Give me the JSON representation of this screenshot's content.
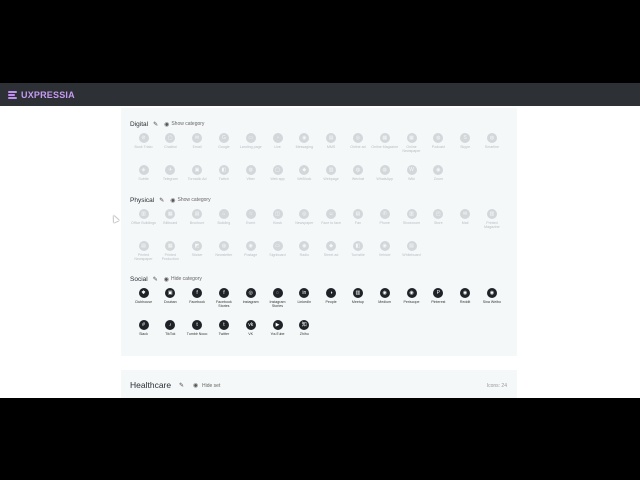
{
  "app": {
    "logo_text": "UXPRESSIA",
    "accent": "#c79bf2",
    "topbar_color": "#2d3136"
  },
  "categories": [
    {
      "title": "Digital",
      "action": "Show category",
      "state": "faded",
      "items": [
        "Book Trialo",
        "Chatbot",
        "Email",
        "Google",
        "Landing page",
        "Live",
        "Messaging",
        "MMS",
        "Online ad",
        "Online Magazine",
        "Online Newspaper",
        "Podcast",
        "Skype",
        "Smarline",
        "Subtle",
        "Telegram",
        "Tornadic Ad",
        "Twitch",
        "Viber",
        "Web app",
        "WeBlock",
        "Webpage",
        "Wechat",
        "WhatsApp",
        "Wiki",
        "Zoom"
      ]
    },
    {
      "title": "Physical",
      "action": "Show category",
      "state": "faded",
      "items": [
        "Office Buildings",
        "Billboard",
        "Brochure",
        "Building",
        "Event",
        "Kiosk",
        "Newspaper",
        "Face to face",
        "Fax",
        "Phone",
        "Showroom",
        "Store",
        "Mail",
        "Printed Magazine",
        "Printed Newspaper",
        "Printed Production",
        "Sticker",
        "Newsletter",
        "Postage",
        "Signboard",
        "Radio",
        "Street ad",
        "Turnstile",
        "Vehicle",
        "Whiteboard"
      ]
    },
    {
      "title": "Social",
      "action": "Hide category",
      "state": "dark",
      "items": [
        "Clubhouse",
        "Douban",
        "Facebook",
        "Facebook Stories",
        "Instagram",
        "Instagram Stories",
        "LinkedIn",
        "People",
        "Meetup",
        "Medium",
        "Periscope",
        "Pinterest",
        "Reddit",
        "Sina Weibo",
        "Slack",
        "TikTok",
        "Tumblr Nooo",
        "Twitter",
        "VK",
        "YouTube",
        "Zhihu"
      ]
    }
  ],
  "healthcare": {
    "title": "Healthcare",
    "action": "Hide set",
    "count": "Icons: 24"
  },
  "icon_glyphs": {
    "Digital": [
      "⊘",
      "▢",
      "✉",
      "G",
      "▭",
      "◔",
      "◉",
      "▤",
      "◎",
      "▦",
      "▦",
      "◍",
      "S",
      "◍",
      "◈",
      "✈",
      "▣",
      "◧",
      "◍",
      "▢",
      "◆",
      "▥",
      "◍",
      "◍",
      "W",
      "◉"
    ],
    "Physical": [
      "▥",
      "▦",
      "▤",
      "⌂",
      "☆",
      "◫",
      "◎",
      "☺",
      "▤",
      "✆",
      "▥",
      "◰",
      "✉",
      "▥",
      "▤",
      "▦",
      "◩",
      "◍",
      "◉",
      "▭",
      "◉",
      "◆",
      "◧",
      "◉",
      "▤"
    ],
    "Social": [
      "✱",
      "▣",
      "f",
      "f",
      "◎",
      "◌",
      "in",
      "◑",
      "▥",
      "◉",
      "◉",
      "P",
      "◉",
      "◉",
      "#",
      "♪",
      "t",
      "t",
      "vk",
      "▶",
      "知"
    ]
  }
}
